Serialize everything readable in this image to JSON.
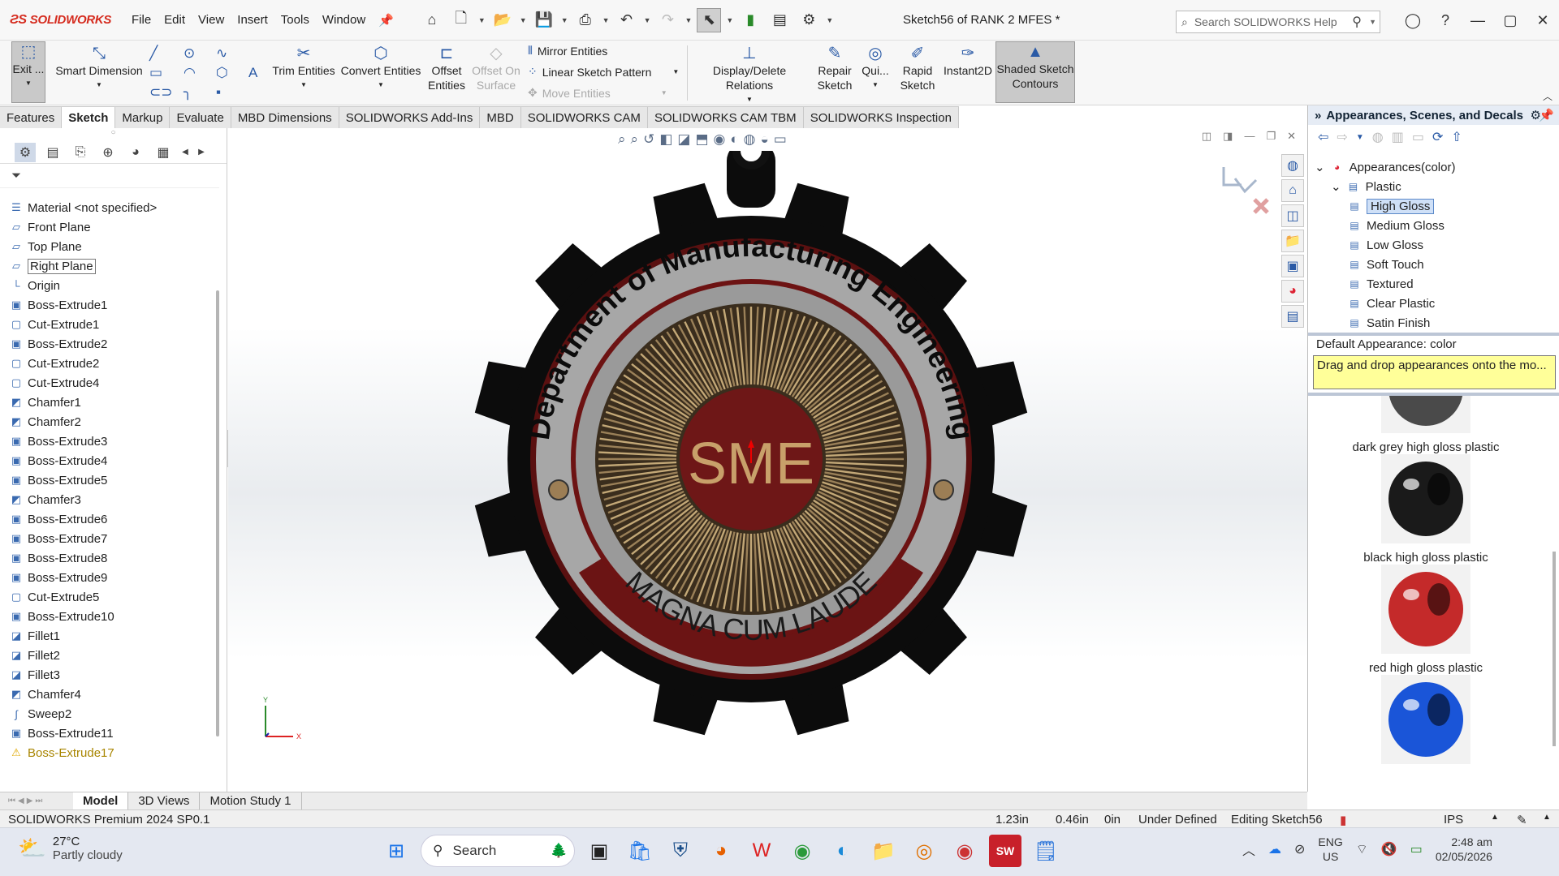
{
  "titlebar": {
    "app_name": "SOLIDWORKS",
    "menus": [
      "File",
      "Edit",
      "View",
      "Insert",
      "Tools",
      "Window"
    ],
    "document_title": "Sketch56 of RANK 2 MFES *",
    "search_placeholder": "Search SOLIDWORKS Help"
  },
  "ribbon": {
    "exit_label": "Exit ...",
    "smart_dimension": "Smart Dimension",
    "trim_entities": "Trim Entities",
    "convert_entities": "Convert Entities",
    "offset_entities_1": "Offset",
    "offset_entities_2": "Entities",
    "offset_on_surface_1": "Offset On",
    "offset_on_surface_2": "Surface",
    "mirror_entities": "Mirror Entities",
    "linear_sketch_pattern": "Linear Sketch Pattern",
    "move_entities": "Move Entities",
    "display_delete_relations": "Display/Delete Relations",
    "repair_sketch_1": "Repair",
    "repair_sketch_2": "Sketch",
    "quick_snaps": "Qui...",
    "rapid_sketch_1": "Rapid",
    "rapid_sketch_2": "Sketch",
    "instant2d": "Instant2D",
    "shaded_contours_1": "Shaded Sketch",
    "shaded_contours_2": "Contours"
  },
  "tabs": [
    "Features",
    "Sketch",
    "Markup",
    "Evaluate",
    "MBD Dimensions",
    "SOLIDWORKS Add-Ins",
    "MBD",
    "SOLIDWORKS CAM",
    "SOLIDWORKS CAM TBM",
    "SOLIDWORKS Inspection"
  ],
  "active_tab": "Sketch",
  "feature_tree": [
    {
      "label": "Material <not specified>",
      "icon": "material-icon"
    },
    {
      "label": "Front Plane",
      "icon": "plane-icon"
    },
    {
      "label": "Top Plane",
      "icon": "plane-icon"
    },
    {
      "label": "Right Plane",
      "icon": "plane-icon",
      "boxed": true
    },
    {
      "label": "Origin",
      "icon": "origin-icon"
    },
    {
      "label": "Boss-Extrude1",
      "icon": "extrude-icon"
    },
    {
      "label": "Cut-Extrude1",
      "icon": "cut-icon"
    },
    {
      "label": "Boss-Extrude2",
      "icon": "extrude-icon"
    },
    {
      "label": "Cut-Extrude2",
      "icon": "cut-icon"
    },
    {
      "label": "Cut-Extrude4",
      "icon": "cut-icon"
    },
    {
      "label": "Chamfer1",
      "icon": "chamfer-icon"
    },
    {
      "label": "Chamfer2",
      "icon": "chamfer-icon"
    },
    {
      "label": "Boss-Extrude3",
      "icon": "extrude-icon"
    },
    {
      "label": "Boss-Extrude4",
      "icon": "extrude-icon"
    },
    {
      "label": "Boss-Extrude5",
      "icon": "extrude-icon"
    },
    {
      "label": "Chamfer3",
      "icon": "chamfer-icon"
    },
    {
      "label": "Boss-Extrude6",
      "icon": "extrude-icon"
    },
    {
      "label": "Boss-Extrude7",
      "icon": "extrude-icon"
    },
    {
      "label": "Boss-Extrude8",
      "icon": "extrude-icon"
    },
    {
      "label": "Boss-Extrude9",
      "icon": "extrude-icon"
    },
    {
      "label": "Cut-Extrude5",
      "icon": "cut-icon"
    },
    {
      "label": "Boss-Extrude10",
      "icon": "extrude-icon"
    },
    {
      "label": "Fillet1",
      "icon": "fillet-icon"
    },
    {
      "label": "Fillet2",
      "icon": "fillet-icon"
    },
    {
      "label": "Fillet3",
      "icon": "fillet-icon"
    },
    {
      "label": "Chamfer4",
      "icon": "chamfer-icon"
    },
    {
      "label": "Sweep2",
      "icon": "sweep-icon"
    },
    {
      "label": "Boss-Extrude11",
      "icon": "extrude-icon"
    },
    {
      "label": "Boss-Extrude17",
      "icon": "warning-icon",
      "warn": true
    }
  ],
  "model": {
    "medal_top_text": "Department of Manufacturing Engineering",
    "medal_bottom_text": "MAGNA CUM LAUDE",
    "medal_center_text": "SME",
    "colors": {
      "gear": "#111111",
      "ring_red": "#7a1414",
      "ring_gray": "#a9a9a9",
      "center": "#7a1818",
      "rays": "#b49a6a",
      "text_center": "#c9a36b"
    }
  },
  "task_pane": {
    "title": "Appearances, Scenes, and Decals",
    "tree": [
      {
        "label": "Appearances(color)",
        "level": 0
      },
      {
        "label": "Plastic",
        "level": 1
      },
      {
        "label": "High Gloss",
        "level": 2,
        "selected": true
      },
      {
        "label": "Medium Gloss",
        "level": 2
      },
      {
        "label": "Low Gloss",
        "level": 2
      },
      {
        "label": "Soft Touch",
        "level": 2
      },
      {
        "label": "Textured",
        "level": 2
      },
      {
        "label": "Clear Plastic",
        "level": 2
      },
      {
        "label": "Satin Finish",
        "level": 2
      }
    ],
    "default_appearance": "Default Appearance: color",
    "tip": "Drag and drop appearances onto the mo...",
    "swatches": [
      {
        "label": "dark grey high gloss plastic",
        "color": "#4a4a4a"
      },
      {
        "label": "black high gloss plastic",
        "color": "#1a1a1a"
      },
      {
        "label": "red high gloss plastic",
        "color": "#c42a2a"
      },
      {
        "label": "",
        "color": "#1a55d8"
      }
    ]
  },
  "model_tabs": [
    "Model",
    "3D Views",
    "Motion Study 1"
  ],
  "status": {
    "product": "SOLIDWORKS Premium 2024 SP0.1",
    "x": "1.23in",
    "y": "0.46in",
    "z": "0in",
    "state": "Under Defined",
    "editing": "Editing Sketch56",
    "units": "IPS"
  },
  "taskbar": {
    "temp": "27°C",
    "weather": "Partly cloudy",
    "search": "Search",
    "lang1": "ENG",
    "lang2": "US",
    "time": "2:48 am",
    "date": "02/05/2026"
  }
}
